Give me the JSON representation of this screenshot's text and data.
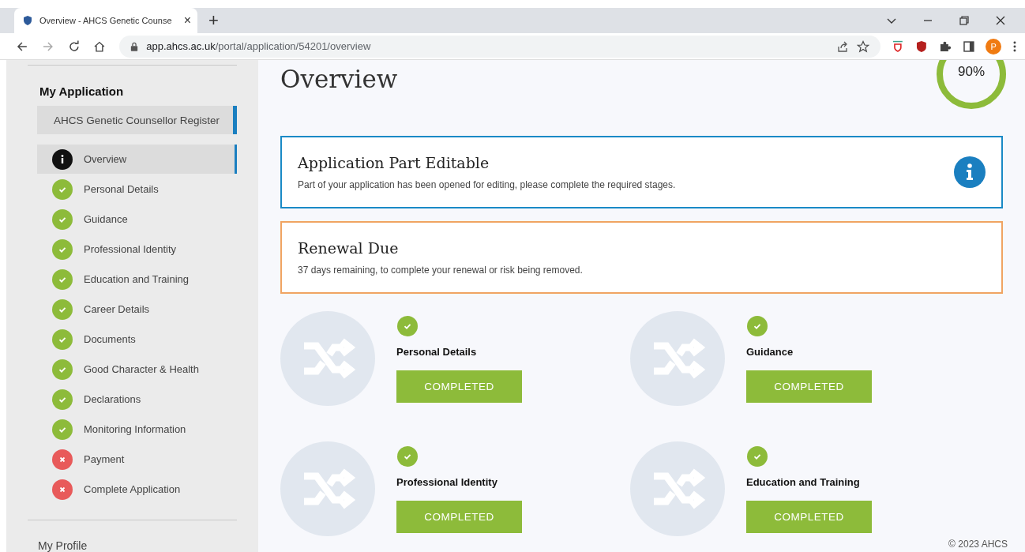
{
  "browser": {
    "tab_title": "Overview - AHCS Genetic Counse",
    "tab_close": "×",
    "new_tab": "+",
    "url_host": "app.ahcs.ac.uk",
    "url_path": "/portal/application/54201/overview",
    "profile_initial": "P"
  },
  "sidebar": {
    "heading": "My Application",
    "register": "AHCS Genetic Counsellor Register",
    "items": [
      {
        "label": "Overview",
        "kind": "info",
        "selected": true
      },
      {
        "label": "Personal Details",
        "kind": "done",
        "selected": false
      },
      {
        "label": "Guidance",
        "kind": "done",
        "selected": false
      },
      {
        "label": "Professional Identity",
        "kind": "done",
        "selected": false
      },
      {
        "label": "Education and Training",
        "kind": "done",
        "selected": false
      },
      {
        "label": "Career Details",
        "kind": "done",
        "selected": false
      },
      {
        "label": "Documents",
        "kind": "done",
        "selected": false
      },
      {
        "label": "Good Character & Health",
        "kind": "done",
        "selected": false
      },
      {
        "label": "Declarations",
        "kind": "done",
        "selected": false
      },
      {
        "label": "Monitoring Information",
        "kind": "done",
        "selected": false
      },
      {
        "label": "Payment",
        "kind": "failed",
        "selected": false
      },
      {
        "label": "Complete Application",
        "kind": "failed",
        "selected": false
      }
    ],
    "profile_link": "My Profile"
  },
  "main": {
    "title": "Overview",
    "progress": {
      "reading": "90%"
    },
    "notices": [
      {
        "kind": "info",
        "title": "Application Part Editable",
        "text": "Part of your application has been opened for editing, please complete the required stages."
      },
      {
        "kind": "warning",
        "title": "Renewal Due",
        "text": "37 days remaining, to complete your renewal or risk being removed."
      }
    ],
    "stages": [
      {
        "title": "Personal Details",
        "kind": "done",
        "button": "COMPLETED"
      },
      {
        "title": "Guidance",
        "kind": "done",
        "button": "COMPLETED"
      },
      {
        "title": "Professional Identity",
        "kind": "done",
        "button": "COMPLETED"
      },
      {
        "title": "Education and Training",
        "kind": "done",
        "button": "COMPLETED"
      }
    ],
    "footer": "© 2023 AHCS"
  }
}
